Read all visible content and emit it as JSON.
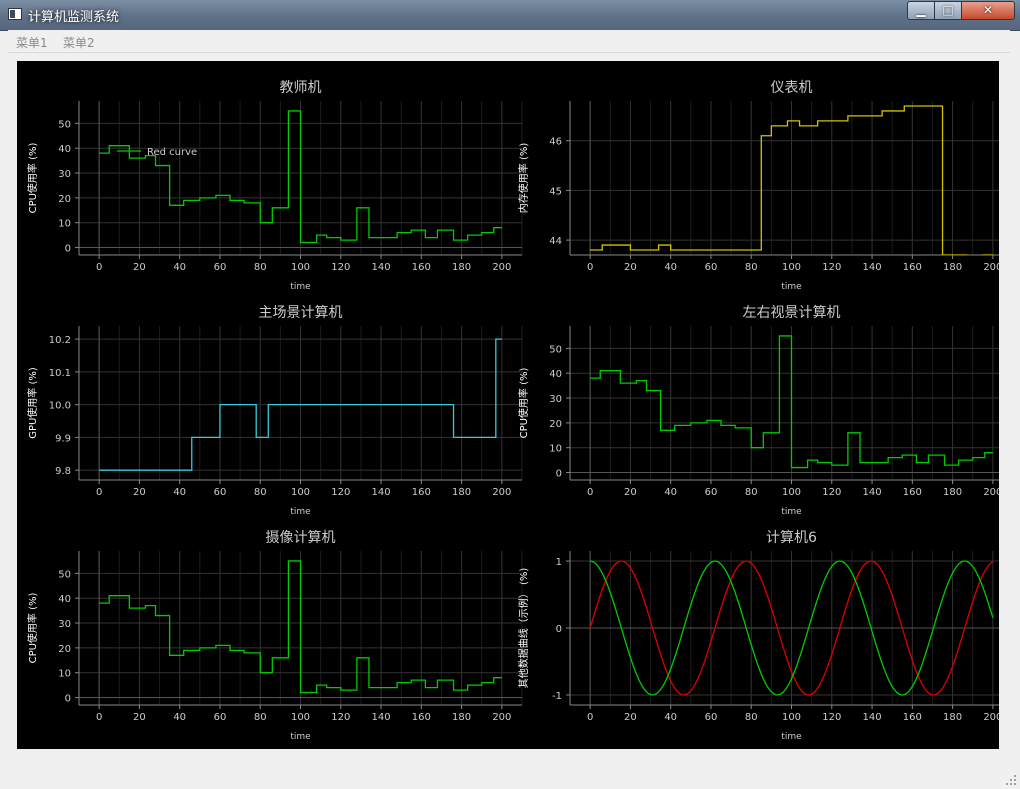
{
  "window": {
    "title": "计算机监测系统"
  },
  "menu": {
    "items": [
      "菜单1",
      "菜单2"
    ]
  },
  "x_tick_labels": [
    "0",
    "20",
    "40",
    "60",
    "80",
    "100",
    "120",
    "140",
    "160",
    "180",
    "200"
  ],
  "x_label": "time",
  "colors": {
    "green": "#00cc00",
    "yellow": "#d4c200",
    "cyan": "#33ccdd",
    "red": "#dd0000",
    "grid": "#333333",
    "axis": "#888888",
    "text": "#cccccc",
    "background": "#000000"
  },
  "chart_data": [
    {
      "type": "line",
      "title": "教师机",
      "ylabel": "CPU使用率 (%)",
      "xlabel": "time",
      "xlim": [
        -10,
        210
      ],
      "ylim": [
        -3,
        59
      ],
      "yticks": [
        0,
        10,
        20,
        30,
        40,
        50
      ],
      "legend": {
        "text": "Red curve",
        "placement": "top-left"
      },
      "series": [
        {
          "color": "green",
          "step": true,
          "x": [
            0,
            5,
            15,
            23,
            28,
            35,
            42,
            50,
            58,
            65,
            72,
            80,
            86,
            94,
            100,
            108,
            113,
            120,
            128,
            134,
            148,
            155,
            162,
            168,
            176,
            183,
            190,
            196,
            200
          ],
          "y": [
            38,
            41,
            36,
            37,
            33,
            17,
            19,
            20,
            21,
            19,
            18,
            10,
            16,
            55,
            2,
            5,
            4,
            3,
            16,
            4,
            6,
            7,
            4,
            7,
            3,
            5,
            6,
            8,
            8
          ]
        }
      ]
    },
    {
      "type": "line",
      "title": "仪表机",
      "ylabel": "内存使用率 (%)",
      "xlabel": "time",
      "xlim": [
        -10,
        210
      ],
      "ylim": [
        43.7,
        46.8
      ],
      "yticks": [
        44,
        45,
        46
      ],
      "series": [
        {
          "color": "yellow",
          "step": true,
          "x": [
            0,
            6,
            20,
            34,
            40,
            85,
            90,
            98,
            104,
            113,
            128,
            145,
            156,
            175,
            187,
            195,
            200
          ],
          "y": [
            43.8,
            43.9,
            43.8,
            43.9,
            43.8,
            46.1,
            46.3,
            46.4,
            46.3,
            46.4,
            46.5,
            46.6,
            46.7,
            43.7,
            43.6,
            43.7,
            43.7
          ]
        }
      ]
    },
    {
      "type": "line",
      "title": "主场景计算机",
      "ylabel": "GPU使用率 (%)",
      "xlabel": "time",
      "xlim": [
        -10,
        210
      ],
      "ylim": [
        9.77,
        10.24
      ],
      "yticks": [
        9.8,
        9.9,
        10.0,
        10.1,
        10.2
      ],
      "series": [
        {
          "color": "cyan",
          "step": true,
          "x": [
            0,
            46,
            60,
            78,
            84,
            176,
            197,
            200
          ],
          "y": [
            9.8,
            9.9,
            10.0,
            9.9,
            10.0,
            9.9,
            10.2,
            10.2
          ]
        }
      ]
    },
    {
      "type": "line",
      "title": "左右视景计算机",
      "ylabel": "CPU使用率 (%)",
      "xlabel": "time",
      "xlim": [
        -10,
        210
      ],
      "ylim": [
        -3,
        59
      ],
      "yticks": [
        0,
        10,
        20,
        30,
        40,
        50
      ],
      "series": [
        {
          "color": "green",
          "step": true,
          "x": [
            0,
            5,
            15,
            23,
            28,
            35,
            42,
            50,
            58,
            65,
            72,
            80,
            86,
            94,
            100,
            108,
            113,
            120,
            128,
            134,
            148,
            155,
            162,
            168,
            176,
            183,
            190,
            196,
            200
          ],
          "y": [
            38,
            41,
            36,
            37,
            33,
            17,
            19,
            20,
            21,
            19,
            18,
            10,
            16,
            55,
            2,
            5,
            4,
            3,
            16,
            4,
            6,
            7,
            4,
            7,
            3,
            5,
            6,
            8,
            8
          ]
        }
      ]
    },
    {
      "type": "line",
      "title": "摄像计算机",
      "ylabel": "CPU使用率 (%)",
      "xlabel": "time",
      "xlim": [
        -10,
        210
      ],
      "ylim": [
        -3,
        59
      ],
      "yticks": [
        0,
        10,
        20,
        30,
        40,
        50
      ],
      "series": [
        {
          "color": "green",
          "step": true,
          "x": [
            0,
            5,
            15,
            23,
            28,
            35,
            42,
            50,
            58,
            65,
            72,
            80,
            86,
            94,
            100,
            108,
            113,
            120,
            128,
            134,
            148,
            155,
            162,
            168,
            176,
            183,
            190,
            196,
            200
          ],
          "y": [
            38,
            41,
            36,
            37,
            33,
            17,
            19,
            20,
            21,
            19,
            18,
            10,
            16,
            55,
            2,
            5,
            4,
            3,
            16,
            4,
            6,
            7,
            4,
            7,
            3,
            5,
            6,
            8,
            8
          ]
        }
      ]
    },
    {
      "type": "line",
      "title": "计算机6",
      "ylabel": "其他数据曲线（示例） (%)",
      "xlabel": "time",
      "xlim": [
        -10,
        210
      ],
      "ylim": [
        -1.15,
        1.15
      ],
      "yticks": [
        -1,
        0,
        1
      ],
      "series": [
        {
          "color": "red",
          "function": "sin",
          "period": 62,
          "phase": 0
        },
        {
          "color": "green",
          "function": "cos",
          "period": 62,
          "phase": 0
        }
      ]
    }
  ]
}
